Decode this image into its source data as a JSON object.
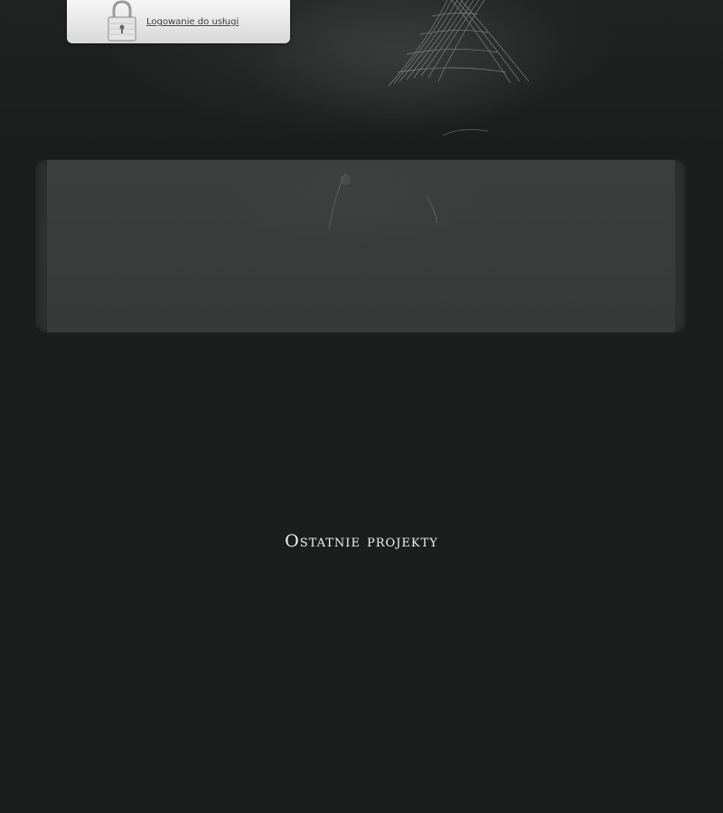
{
  "header": {
    "login": {
      "label": "Logowanie do usługi",
      "icon": "padlock-icon"
    }
  },
  "main": {
    "section_title": "Ostatnie projekty"
  },
  "colors": {
    "background": "#1c1e1e",
    "slider_frame": "#2e3030",
    "slider_panel": "#3c3e3e",
    "login_box": "#e8e8e8",
    "title_text": "#f2f2f2"
  }
}
